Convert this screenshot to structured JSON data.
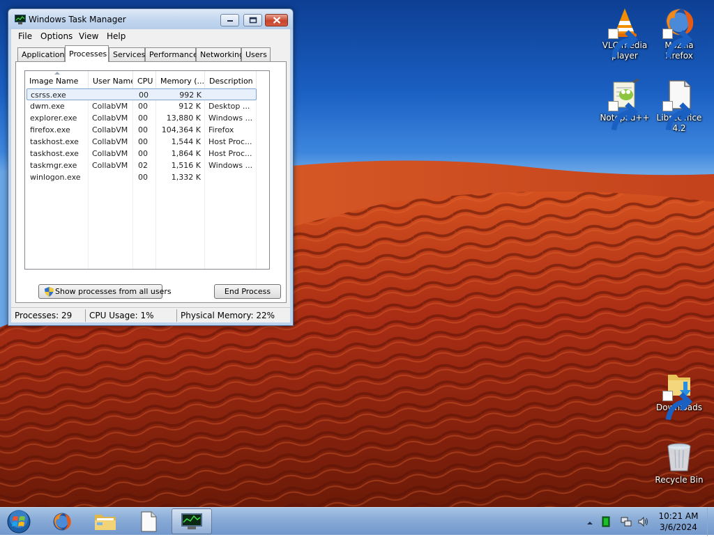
{
  "desktop": {
    "icons": [
      {
        "label": "VLC media player",
        "icon": "vlc-cone-icon"
      },
      {
        "label": "Mozilla Firefox",
        "icon": "firefox-icon"
      },
      {
        "label": "Notepad++",
        "icon": "notepadpp-icon"
      },
      {
        "label": "LibreOffice 4.2",
        "icon": "libreoffice-document-icon"
      },
      {
        "label": "Downloads",
        "icon": "downloads-folder-icon"
      },
      {
        "label": "Recycle Bin",
        "icon": "recycle-bin-icon"
      }
    ]
  },
  "window": {
    "title": "Windows Task Manager",
    "menu": [
      "File",
      "Options",
      "View",
      "Help"
    ],
    "tabs": [
      "Applications",
      "Processes",
      "Services",
      "Performance",
      "Networking",
      "Users"
    ],
    "active_tab": "Processes",
    "columns": [
      "Image Name",
      "User Name",
      "CPU",
      "Memory (...",
      "Description"
    ],
    "processes": [
      {
        "name": "csrss.exe",
        "user": "",
        "cpu": "00",
        "memory": "992 K",
        "description": ""
      },
      {
        "name": "dwm.exe",
        "user": "CollabVM",
        "cpu": "00",
        "memory": "912 K",
        "description": "Desktop ..."
      },
      {
        "name": "explorer.exe",
        "user": "CollabVM",
        "cpu": "00",
        "memory": "13,880 K",
        "description": "Windows ..."
      },
      {
        "name": "firefox.exe",
        "user": "CollabVM",
        "cpu": "00",
        "memory": "104,364 K",
        "description": "Firefox"
      },
      {
        "name": "taskhost.exe",
        "user": "CollabVM",
        "cpu": "00",
        "memory": "1,544 K",
        "description": "Host Proc..."
      },
      {
        "name": "taskhost.exe",
        "user": "CollabVM",
        "cpu": "00",
        "memory": "1,864 K",
        "description": "Host Proc..."
      },
      {
        "name": "taskmgr.exe",
        "user": "CollabVM",
        "cpu": "02",
        "memory": "1,516 K",
        "description": "Windows ..."
      },
      {
        "name": "winlogon.exe",
        "user": "",
        "cpu": "00",
        "memory": "1,332 K",
        "description": ""
      }
    ],
    "selected_row": 0,
    "show_all_button": "Show processes from all users",
    "end_process_button": "End Process",
    "status": {
      "processes": "Processes: 29",
      "cpu": "CPU Usage: 1%",
      "memory": "Physical Memory: 22%"
    }
  },
  "taskbar": {
    "buttons": [
      "start-orb-icon",
      "firefox-icon",
      "explorer-folder-icon",
      "document-icon",
      "task-manager-icon"
    ],
    "active_button": "task-manager-icon",
    "tray_icons": [
      "show-hidden-icons-chevron",
      "green-app-icon",
      "network-icon",
      "volume-icon"
    ],
    "clock_time": "10:21 AM",
    "clock_date": "3/6/2024"
  },
  "colors": {
    "sky": "#1a5fc2",
    "dune": "#b8361a",
    "taskbar": "#87aad6",
    "selection": "#e8f1fb"
  }
}
